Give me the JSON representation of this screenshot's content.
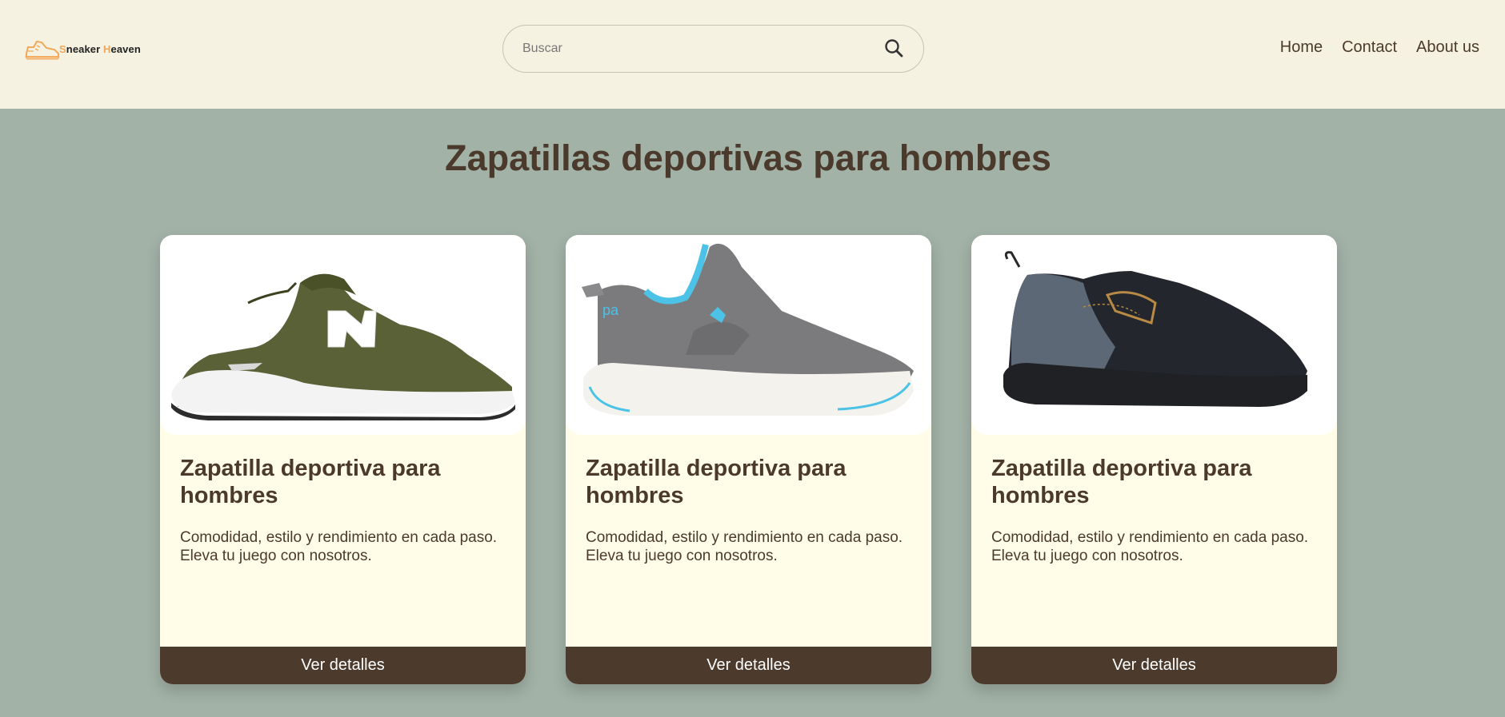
{
  "header": {
    "logo": {
      "text_first_letter": "S",
      "text_mid": "neaker ",
      "text_second_letter": "H",
      "text_end": "eaven",
      "accent_color": "#f1a85a"
    },
    "search": {
      "placeholder": "Buscar",
      "value": "",
      "icon": "search-icon"
    },
    "nav": [
      {
        "label": "Home"
      },
      {
        "label": "Contact"
      },
      {
        "label": "About us"
      }
    ]
  },
  "main": {
    "title": "Zapatillas deportivas para hombres",
    "products": [
      {
        "image": "olive-green-new-balance-sneaker",
        "title": "Zapatilla deportiva para hombres",
        "description": "Comodidad, estilo y rendimiento en cada paso. Eleva tu juego con nosotros.",
        "button": "Ver detalles"
      },
      {
        "image": "grey-blue-kappa-sneaker",
        "title": "Zapatilla deportiva para hombres",
        "description": "Comodidad, estilo y rendimiento en cada paso. Eleva tu juego con nosotros.",
        "button": "Ver detalles"
      },
      {
        "image": "black-running-sneaker",
        "title": "Zapatilla deportiva para hombres",
        "description": "Comodidad, estilo y rendimiento en cada paso. Eleva tu juego con nosotros.",
        "button": "Ver detalles"
      }
    ]
  },
  "colors": {
    "header_bg": "#f6f2e2",
    "page_bg": "#a2b2a7",
    "card_bg": "#fffde8",
    "text_brown": "#4b3a2b",
    "button_bg": "#4c3a2c"
  }
}
